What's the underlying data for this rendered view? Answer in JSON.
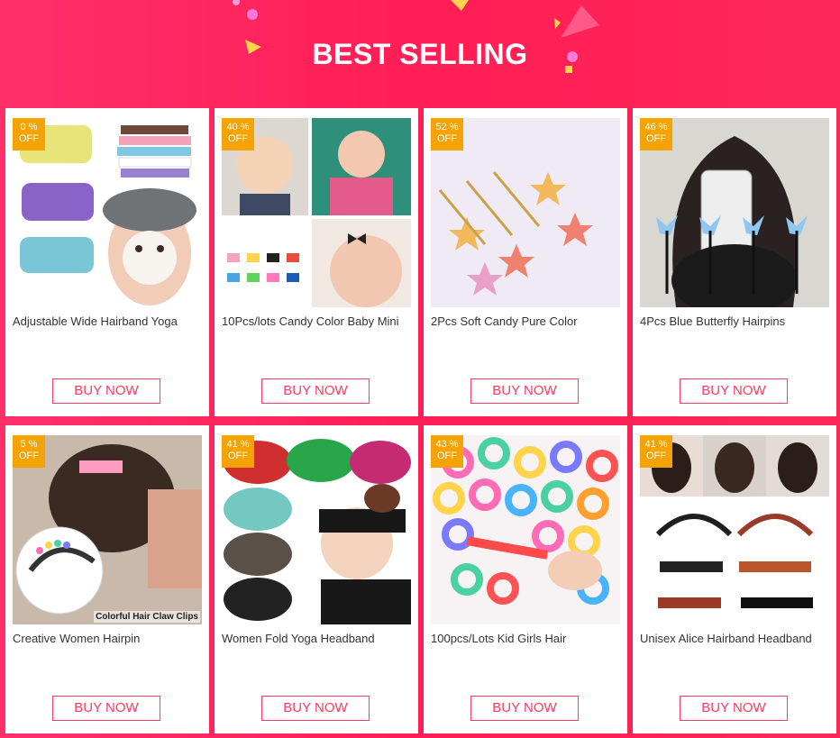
{
  "banner": {
    "title": "BEST SELLING",
    "colors": {
      "background": "#ff2458",
      "accent": "#f5a300",
      "button": "#ff3a63"
    }
  },
  "products": [
    {
      "name": "Adjustable Wide Hairband Yoga",
      "discount": "0 %",
      "off": "OFF",
      "button": "BUY NOW",
      "image": "hairband-towels-image"
    },
    {
      "name": "10Pcs/lots Candy Color Baby Mini",
      "discount": "40 %",
      "off": "OFF",
      "button": "BUY NOW",
      "image": "baby-hair-bows-image"
    },
    {
      "name": "2Pcs Soft Candy Pure Color",
      "discount": "52 %",
      "off": "OFF",
      "button": "BUY NOW",
      "image": "star-hairpins-image"
    },
    {
      "name": "4Pcs Blue Butterfly Hairpins",
      "discount": "46 %",
      "off": "OFF",
      "button": "BUY NOW",
      "image": "butterfly-hairpins-image"
    },
    {
      "name": "Creative Women Hairpin",
      "discount": "5 %",
      "off": "OFF",
      "button": "BUY NOW",
      "image": "hair-claw-clips-image",
      "image_caption": "Colorful Hair Claw Clips"
    },
    {
      "name": "Women Fold Yoga Headband",
      "discount": "41 %",
      "off": "OFF",
      "button": "BUY NOW",
      "image": "fold-headbands-image"
    },
    {
      "name": "100pcs/Lots Kid Girls Hair",
      "discount": "43 %",
      "off": "OFF",
      "button": "BUY NOW",
      "image": "hair-ties-image"
    },
    {
      "name": "Unisex Alice Hairband Headband",
      "discount": "41 %",
      "off": "OFF",
      "button": "BUY NOW",
      "image": "alice-hairband-image"
    }
  ]
}
